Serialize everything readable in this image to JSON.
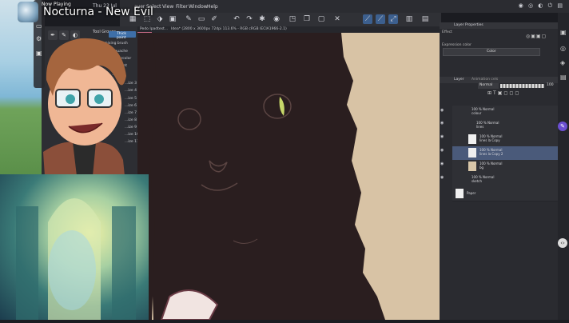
{
  "now_playing": {
    "label": "Now Playing",
    "song": "Nocturna - New Evil"
  },
  "system": {
    "date": "Thu 23 Jul"
  },
  "menubar": {
    "items": [
      "ayer",
      "Select",
      "View",
      "Filter",
      "Window",
      "Help"
    ]
  },
  "document_tab": {
    "label": "Pedo Ipadtest...",
    "file": "Idea* (2800 x 3600px 72dpi 113.6% - RGB cRGB IECIA1966-2.1)"
  },
  "tool_panel": {
    "title": "Tool Groups",
    "items": [
      "Thick paint",
      "Blend mixing brush",
      "Gouache",
      "Watercolor",
      "Oil paint",
      "...size",
      "...ize 3",
      "...ize 4",
      "...ize 5",
      "...ize 6",
      "...ize 7",
      "...ize 8",
      "...ize 9",
      "...ize 10",
      "...ize 11"
    ]
  },
  "layer_properties": {
    "title": "Layer Properties",
    "effect_label": "Effect",
    "expression_color_label": "Expression color",
    "expression_color_value": "Color"
  },
  "layer_panel": {
    "title": "Layer",
    "tab2": "Animation cels",
    "blend_mode": "Normal",
    "opacity": "100",
    "layers": [
      {
        "name": "100 % Normal\ncolour",
        "indent": 0,
        "selected": false
      },
      {
        "name": "100 % Normal\nlines",
        "indent": 1,
        "selected": false
      },
      {
        "name": "100 % Normal\nlines la Copy",
        "indent": 2,
        "selected": false
      },
      {
        "name": "100 % Normal\nlines la Copy 2",
        "indent": 2,
        "selected": true
      },
      {
        "name": "100 % Normal\nbg",
        "indent": 1,
        "selected": false
      },
      {
        "name": "100 % Normal\nsketch",
        "indent": 0,
        "selected": false
      },
      {
        "name": "Paper",
        "indent": 0,
        "selected": false
      }
    ]
  }
}
